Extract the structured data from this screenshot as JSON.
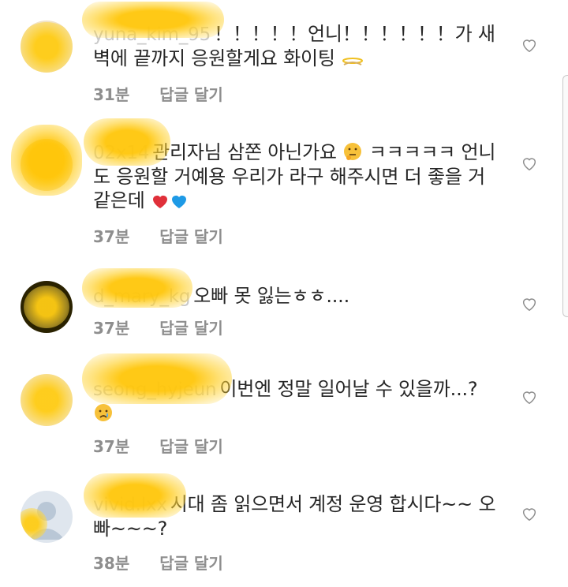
{
  "comments": [
    {
      "username": "yuna_kim_95",
      "text": "！！！！！언니！！！！！！가 새벽에 끝까지 응원할게요 화이팅",
      "time": "31분",
      "reply_label": "답글 달기",
      "emoji": "angel-wing"
    },
    {
      "username": "02x14",
      "text": "관리자님 삼쫀 아닌가요",
      "text2": "ㅋㅋㅋㅋㅋ 언니도 응원할 거예용 우리가 라구 해주시면 더 좋을 거 같은데",
      "time": "37분",
      "reply_label": "답글 달기",
      "emoji": "thinking-face, red-heart, blue-heart"
    },
    {
      "username": "d_mary_kg",
      "text": "오빠 못 잃는ㅎㅎ....",
      "time": "37분",
      "reply_label": "답글 달기"
    },
    {
      "username": "seong_hyjeun",
      "text": "이번엔 정말 일어날 수 있을까...?",
      "time": "37분",
      "reply_label": "답글 달기",
      "emoji": "crying-face"
    },
    {
      "username": "vivid.lxx",
      "text": "시대 좀 읽으면서 계정 운영 합시다~~ 오빠~~~?",
      "time": "38분",
      "reply_label": "답글 달기"
    }
  ],
  "icons": {
    "like": "heart-outline-icon"
  },
  "colors": {
    "text": "#262626",
    "meta": "#8e8e8e",
    "redaction": "#ffc60a"
  }
}
